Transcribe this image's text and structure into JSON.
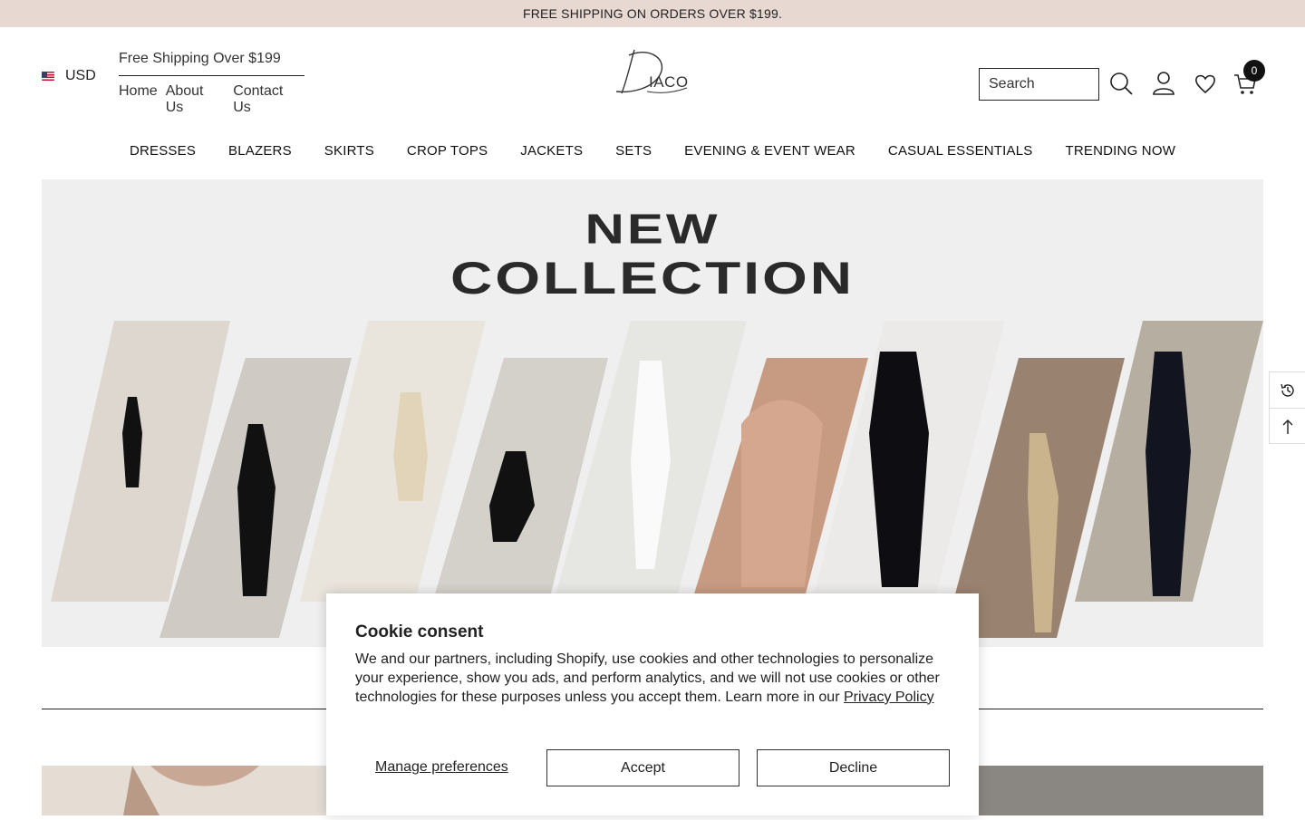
{
  "announcement": "FREE SHIPPING ON ORDERS OVER $199.",
  "currency": {
    "label": "USD",
    "flag_icon": "us-flag-icon"
  },
  "topinfo": {
    "shipping": "Free Shipping Over $199",
    "links": [
      "Home",
      "About Us",
      "Contact Us"
    ]
  },
  "brand": {
    "logo_text": "DIACO"
  },
  "search": {
    "placeholder": "Search"
  },
  "cart": {
    "count": "0"
  },
  "nav": [
    "DRESSES",
    "BLAZERS",
    "SKIRTS",
    "CROP TOPS",
    "JACKETS",
    "SETS",
    "EVENING & EVENT WEAR",
    "CASUAL ESSENTIALS",
    "TRENDING NOW"
  ],
  "hero": {
    "line1": "NEW",
    "line2": "COLLECTION"
  },
  "cookie": {
    "title": "Cookie consent",
    "body": "We and our partners, including Shopify, use cookies and other technologies to personalize your experience, show you ads, and perform analytics, and we will not use cookies or other technologies for these purposes unless you accept them. Learn more in our",
    "policy_link": "Privacy Policy",
    "manage": "Manage preferences",
    "accept": "Accept",
    "decline": "Decline"
  },
  "colors": {
    "announcement_bg": "#e8d8d2",
    "hero_bg": "#efefef",
    "text": "#222222"
  }
}
